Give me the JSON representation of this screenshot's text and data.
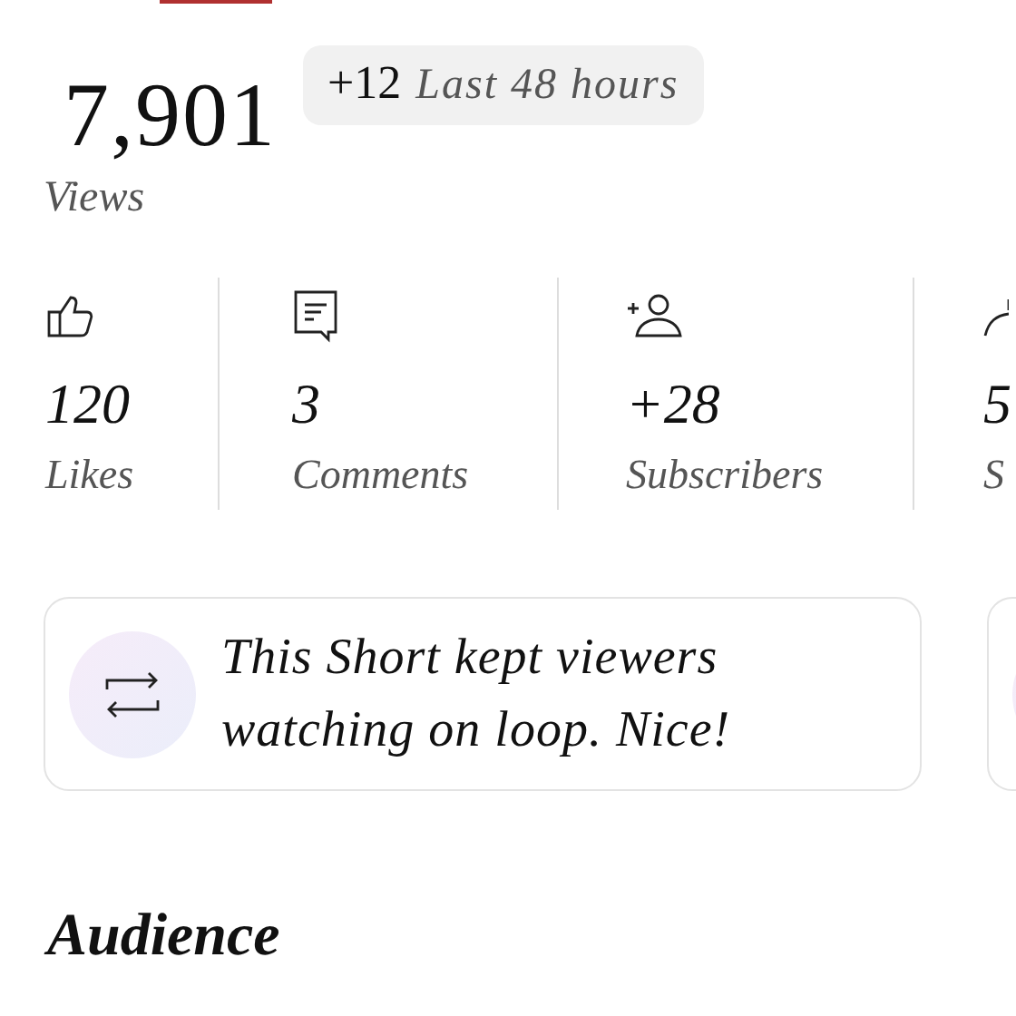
{
  "views": {
    "value": "7,901",
    "label": "Views",
    "change": "+12",
    "period": "Last 48 hours"
  },
  "stats": [
    {
      "kind": "likes",
      "value": "120",
      "label": "Likes"
    },
    {
      "kind": "comments",
      "value": "3",
      "label": "Comments"
    },
    {
      "kind": "subscribers",
      "value": "+28",
      "label": "Subscribers"
    },
    {
      "kind": "shares",
      "value": "5",
      "label": "S"
    }
  ],
  "insights": [
    {
      "kind": "loop",
      "text": "This Short kept viewers watching on loop. Nice!"
    },
    {
      "kind": "card"
    }
  ],
  "section_title": "Audience"
}
